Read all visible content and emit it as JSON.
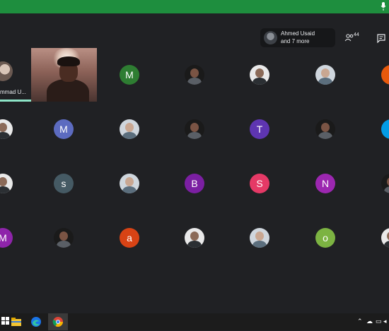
{
  "header": {
    "presenter_name": "Ahmed Usaid",
    "presenter_more": "and 7 more",
    "people_count": "44"
  },
  "participants": [
    {
      "kind": "partial",
      "name": "mmad U..."
    },
    {
      "kind": "video"
    },
    {
      "kind": "letter",
      "letter": "M",
      "color": "#2e7d32"
    },
    {
      "kind": "photo",
      "style": "p3"
    },
    {
      "kind": "photo",
      "style": "p2"
    },
    {
      "kind": "photo",
      "style": "p4"
    },
    {
      "kind": "partial-right",
      "color": "#e8590c"
    },
    {
      "kind": "photo",
      "style": "p2"
    },
    {
      "kind": "letter",
      "letter": "M",
      "color": "#5c6bc0"
    },
    {
      "kind": "photo",
      "style": "p4"
    },
    {
      "kind": "photo",
      "style": "p3"
    },
    {
      "kind": "letter",
      "letter": "T",
      "color": "#5e35b1"
    },
    {
      "kind": "photo",
      "style": "p3"
    },
    {
      "kind": "partial-right",
      "color": "#039be5"
    },
    {
      "kind": "photo",
      "style": "p2"
    },
    {
      "kind": "letter",
      "letter": "s",
      "color": "#455a64"
    },
    {
      "kind": "photo",
      "style": "p4"
    },
    {
      "kind": "letter",
      "letter": "B",
      "color": "#7b1fa2"
    },
    {
      "kind": "letter",
      "letter": "S",
      "color": "#e53966"
    },
    {
      "kind": "letter",
      "letter": "N",
      "color": "#9c27b0"
    },
    {
      "kind": "photo",
      "style": "p3"
    },
    {
      "kind": "letter",
      "letter": "M",
      "color": "#8e24aa"
    },
    {
      "kind": "photo",
      "style": "p3"
    },
    {
      "kind": "letter",
      "letter": "a",
      "color": "#d84315"
    },
    {
      "kind": "photo",
      "style": "p2"
    },
    {
      "kind": "photo",
      "style": "p4"
    },
    {
      "kind": "letter",
      "letter": "o",
      "color": "#7cb342"
    },
    {
      "kind": "photo",
      "style": "p2"
    }
  ],
  "taskbar": {
    "icons": [
      "start-icon",
      "file-explorer-icon",
      "edge-browser-icon",
      "google-chrome-icon"
    ],
    "tray_icons": [
      "chevron-up-icon",
      "onedrive-cloud-icon",
      "network-icon",
      "volume-icon"
    ]
  },
  "colors": {
    "top_bar": "#1e8e3e",
    "background": "#202124",
    "speaking_indicator": "#8ee5c8"
  }
}
